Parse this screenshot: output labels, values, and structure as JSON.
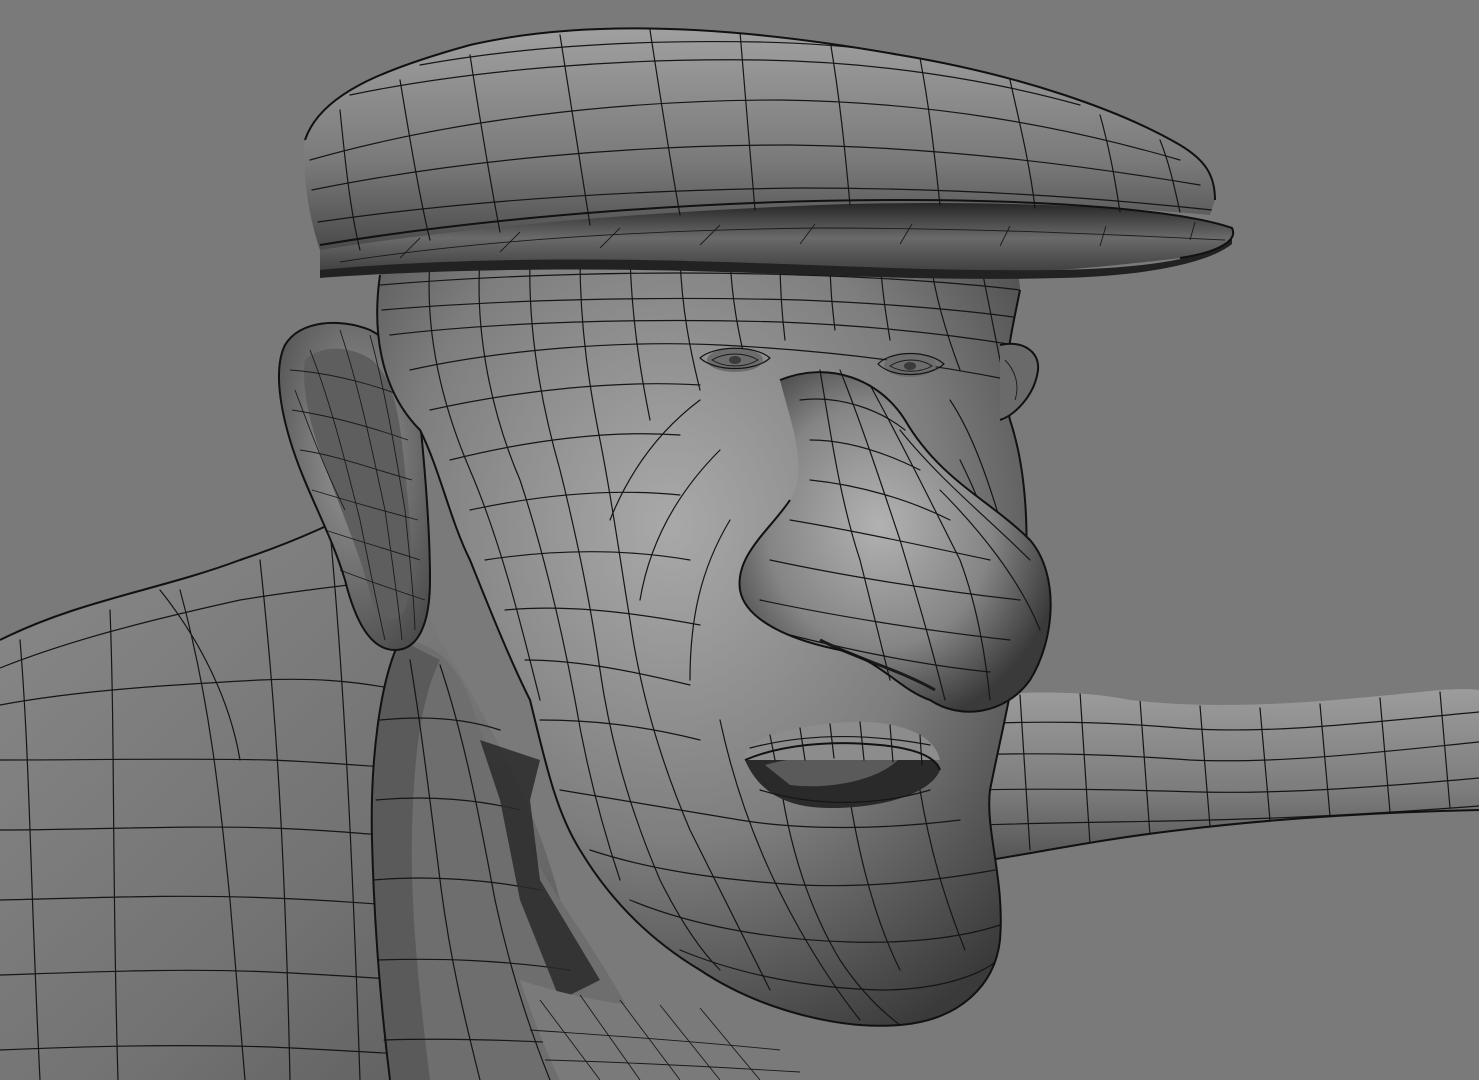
{
  "viewport": {
    "background": "#7a7a7a",
    "mesh_base": "#7c7c7c",
    "mesh_highlight": "#a8a8a8",
    "mesh_shadow": "#2e2e2e",
    "wire_color": "#151515"
  },
  "scene": {
    "subject": "wireframe-shaded-3d-character",
    "objects": [
      "flat-cap",
      "head",
      "ear",
      "nose",
      "mouth",
      "chin",
      "jacket",
      "collar",
      "arm"
    ]
  }
}
